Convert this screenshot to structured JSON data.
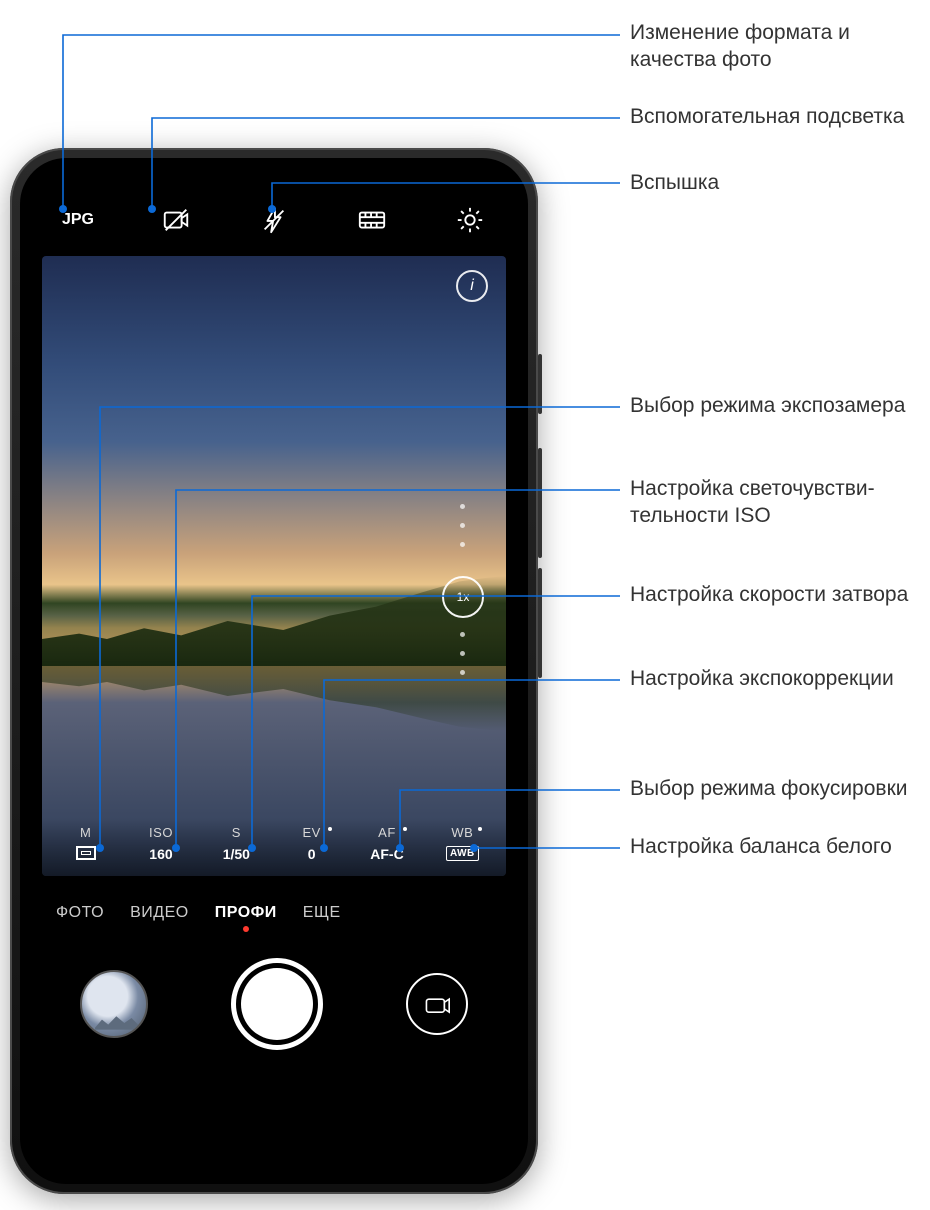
{
  "topbar": {
    "format_label": "JPG",
    "assist_light_icon": "assist-light-icon",
    "flash_icon": "flash-off-icon",
    "grid_icon": "grid-icon",
    "settings_icon": "gear-icon"
  },
  "viewfinder": {
    "info_icon_text": "i",
    "zoom_value": "1x"
  },
  "params": {
    "metering": {
      "label": "M",
      "value_icon": "metering"
    },
    "iso": {
      "label": "ISO",
      "value": "160"
    },
    "shutter": {
      "label": "S",
      "value": "1/50"
    },
    "ev": {
      "label": "EV",
      "value": "0"
    },
    "af": {
      "label": "AF",
      "value": "AF-C"
    },
    "wb": {
      "label": "WB",
      "value": "AWB"
    }
  },
  "modes": {
    "items": [
      "ФОТО",
      "ВИДЕО",
      "ПРОФИ",
      "ЕЩЕ"
    ],
    "active_index": 2
  },
  "callouts": {
    "format": "Изменение формата и качества фото",
    "assist": "Вспомогательная подсветка",
    "flash": "Вспышка",
    "metering": "Выбор режима экспозамера",
    "iso": "Настройка светочувстви­тельности ISO",
    "shutter": "Настройка скорости затвора",
    "ev": "Настройка экспокоррекции",
    "af": "Выбор режима фокусировки",
    "wb": "Настройка баланса белого"
  }
}
